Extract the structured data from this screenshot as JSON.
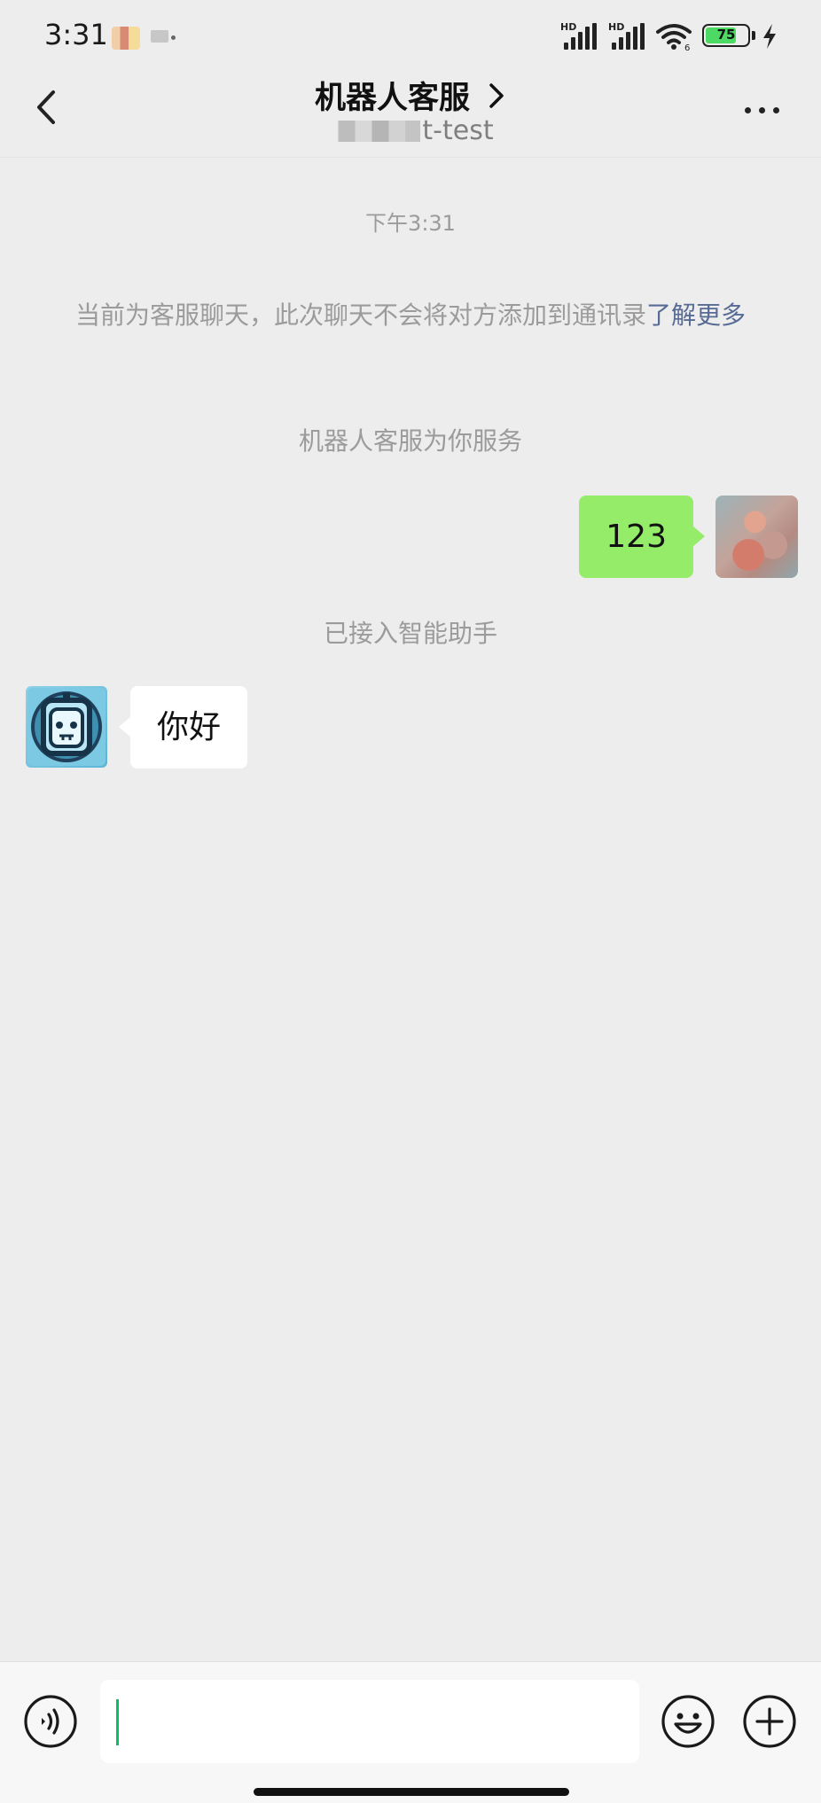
{
  "status_bar": {
    "time": "3:31",
    "battery_level": "75",
    "signal_labels": [
      "HD",
      "HD"
    ],
    "wifi_badge": "6",
    "colors": {
      "battery_fill": "#4cd964"
    }
  },
  "nav": {
    "title": "机器人客服",
    "subtitle": "t-test"
  },
  "chat": {
    "timestamp": "下午3:31",
    "notice_text": "当前为客服聊天，此次聊天不会将对方添加到通讯录",
    "notice_link": "了解更多",
    "service_text": "机器人客服为你服务",
    "connected_text": "已接入智能助手",
    "messages": [
      {
        "side": "right",
        "sender": "user",
        "text": "123"
      },
      {
        "side": "left",
        "sender": "bot",
        "text": "你好"
      }
    ]
  },
  "input_bar": {
    "input_value": "",
    "icons": [
      "voice-icon",
      "emoji-icon",
      "plus-icon"
    ]
  },
  "colors": {
    "background": "#ededed",
    "sent_bubble": "#95ec69",
    "received_bubble": "#ffffff",
    "link": "#576b95",
    "caret": "#07c160"
  }
}
